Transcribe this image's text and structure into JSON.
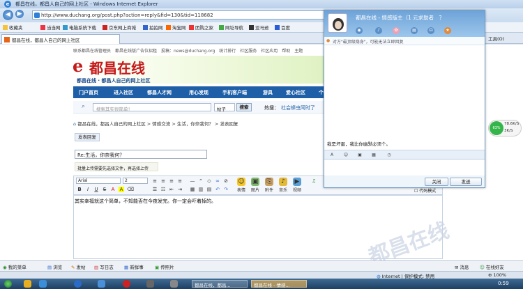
{
  "browser": {
    "title": "都昌在线，都昌人自己的网上社区 - Windows Internet Explorer",
    "url": "http://www.duchang.org/post.php?action=reply&fid=130&tid=118682",
    "tab_label": "都昌在线，都昌人自己的网上社区",
    "tools_label": "工具(O)",
    "favorites_label": "收藏夹",
    "favorites": [
      "当当网",
      "电脑系统下载",
      "京东网上商城",
      "拍拍网",
      "淘宝网",
      "团购之家",
      "网址导航",
      "亚马逊",
      "百度"
    ]
  },
  "site": {
    "top_links": "联系都昌在线管理员　都昌在线版广告位招租　投稿：news@duchang.org　统计排行　社区服务　社区应用　帮助　主题",
    "logo_text": "都昌在线",
    "logo_sub": "都昌在线 · 都昌人自己的网上社区",
    "nav": [
      "门户首页",
      "进入社区",
      "都昌人才网",
      "用心发现",
      "手机客户端",
      "游具",
      "爱心社区",
      "个"
    ],
    "search_placeholder": "搜索其实很简单！",
    "search_scope": "帖子",
    "search_button": "搜索",
    "hot_label": "热搜：",
    "hot_item": "社会蟑虫阿时了",
    "breadcrumb": "都昌在线，都昌人自己的网上社区 > 情感交流 > 生活，你奈我何？ > 发表回复",
    "reply_tab": "发表回复",
    "subject_value": "Re:生活，你奈我何？",
    "upload_note": "批量上传需要先选择文件，再选择上传",
    "editor": {
      "font": "Arial",
      "size": "2",
      "tools": [
        "表情",
        "图片",
        "附件",
        "音乐",
        "视频"
      ],
      "code_mode": "代码模式",
      "content": "其实幸福就这个简单，不知能否在今夜发完。你一定会吓着掉的。"
    },
    "watermark": "都昌在线"
  },
  "page_bar": {
    "items": [
      "我的菜单",
      "浏览",
      "发帖",
      "写日志",
      "新鲜事",
      "传照片"
    ],
    "messages": "消息",
    "online": "在线好友"
  },
  "statusbar": {
    "zone": "Internet | 保护模式: 禁用",
    "zoom": "100%"
  },
  "taskbar": {
    "tasks": [
      "都昌在线，都昌...",
      "都昌在线 - 情感..."
    ],
    "clock": "0:59"
  },
  "qq": {
    "title": "都昌在线 - 情感版主（1 元求助者　？",
    "notice": "对方\"最顶级隐身\"，可能无法立即回复",
    "message": "我是坏蛋，我比你幽默必须个。",
    "close_button": "关闭",
    "send_button": "发送"
  },
  "speed": {
    "percent": "63%",
    "up": "78.6K/S",
    "down": "3K/S"
  }
}
